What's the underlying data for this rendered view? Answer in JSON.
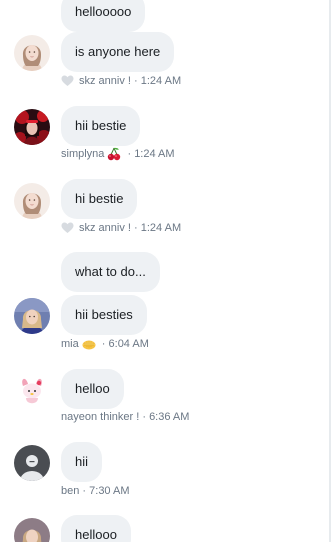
{
  "messages": {
    "m0": {
      "text": "hellooooo"
    },
    "m1": {
      "text": "is anyone here",
      "author": "skz anniv !",
      "time": "1:24 AM"
    },
    "m2": {
      "text": "hii bestie",
      "author": "simplyna",
      "time": "1:24 AM"
    },
    "m3": {
      "text": "hi bestie",
      "author": "skz anniv !",
      "time": "1:24 AM"
    },
    "m4": {
      "text": "what to do..."
    },
    "m5": {
      "text": "hii besties",
      "author": "mia",
      "time": "6:04 AM"
    },
    "m6": {
      "text": "helloo",
      "author": "nayeon thinker !",
      "time": "6:36 AM"
    },
    "m7": {
      "text": "hii",
      "author": "ben",
      "time": "7:30 AM"
    },
    "m8": {
      "text": "hellooo"
    }
  },
  "separator": " · ",
  "icons": {
    "heart": "heart-icon",
    "cherry": "cherry-icon",
    "sun": "sun-emoji-icon"
  },
  "colors": {
    "bubble": "#eef1f4",
    "meta_text": "#6b7785",
    "heart": "#d7dbe0",
    "cherry": "#c8102e"
  }
}
